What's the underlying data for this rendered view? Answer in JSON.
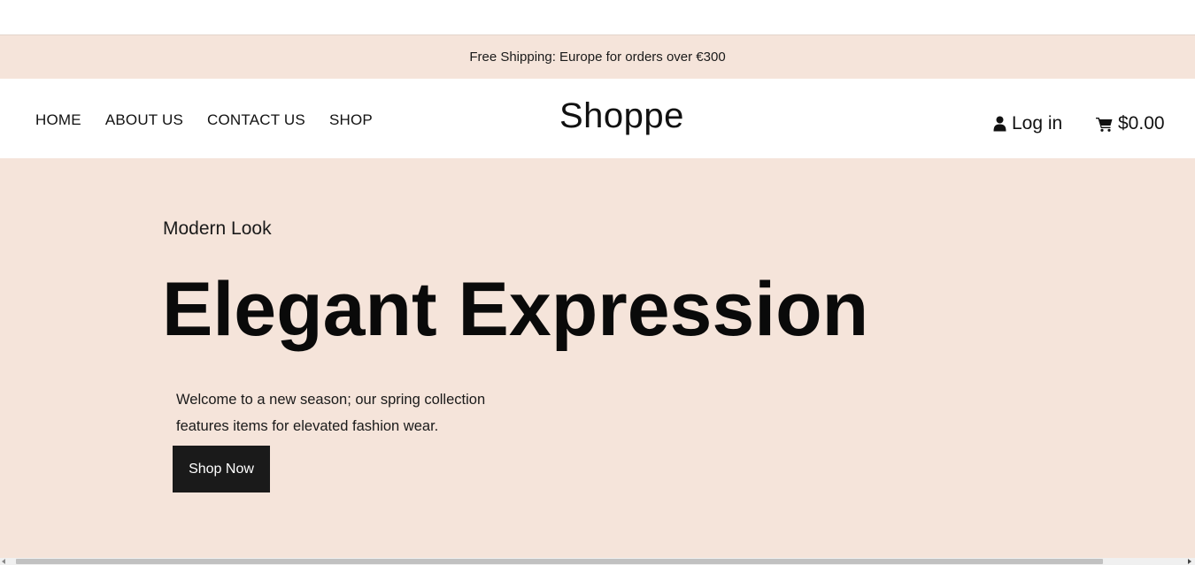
{
  "announcement": {
    "text": "Free Shipping: Europe for orders over €300"
  },
  "nav": {
    "items": [
      {
        "label": "HOME"
      },
      {
        "label": "ABOUT US"
      },
      {
        "label": "CONTACT US"
      },
      {
        "label": "SHOP"
      }
    ]
  },
  "brand": {
    "logo_text": "Shoppe"
  },
  "account": {
    "login_label": "Log in",
    "login_icon": "user-icon"
  },
  "cart": {
    "total": "$0.00",
    "icon": "cart-icon"
  },
  "hero": {
    "eyebrow": "Modern Look",
    "headline": "Elegant Expression",
    "description": "Welcome to a new season; our spring collection features items for elevated fashion wear.",
    "cta_label": "Shop Now"
  },
  "colors": {
    "accent_background": "#f5e4da",
    "button_background": "#1a1a1a",
    "text": "#111111"
  }
}
